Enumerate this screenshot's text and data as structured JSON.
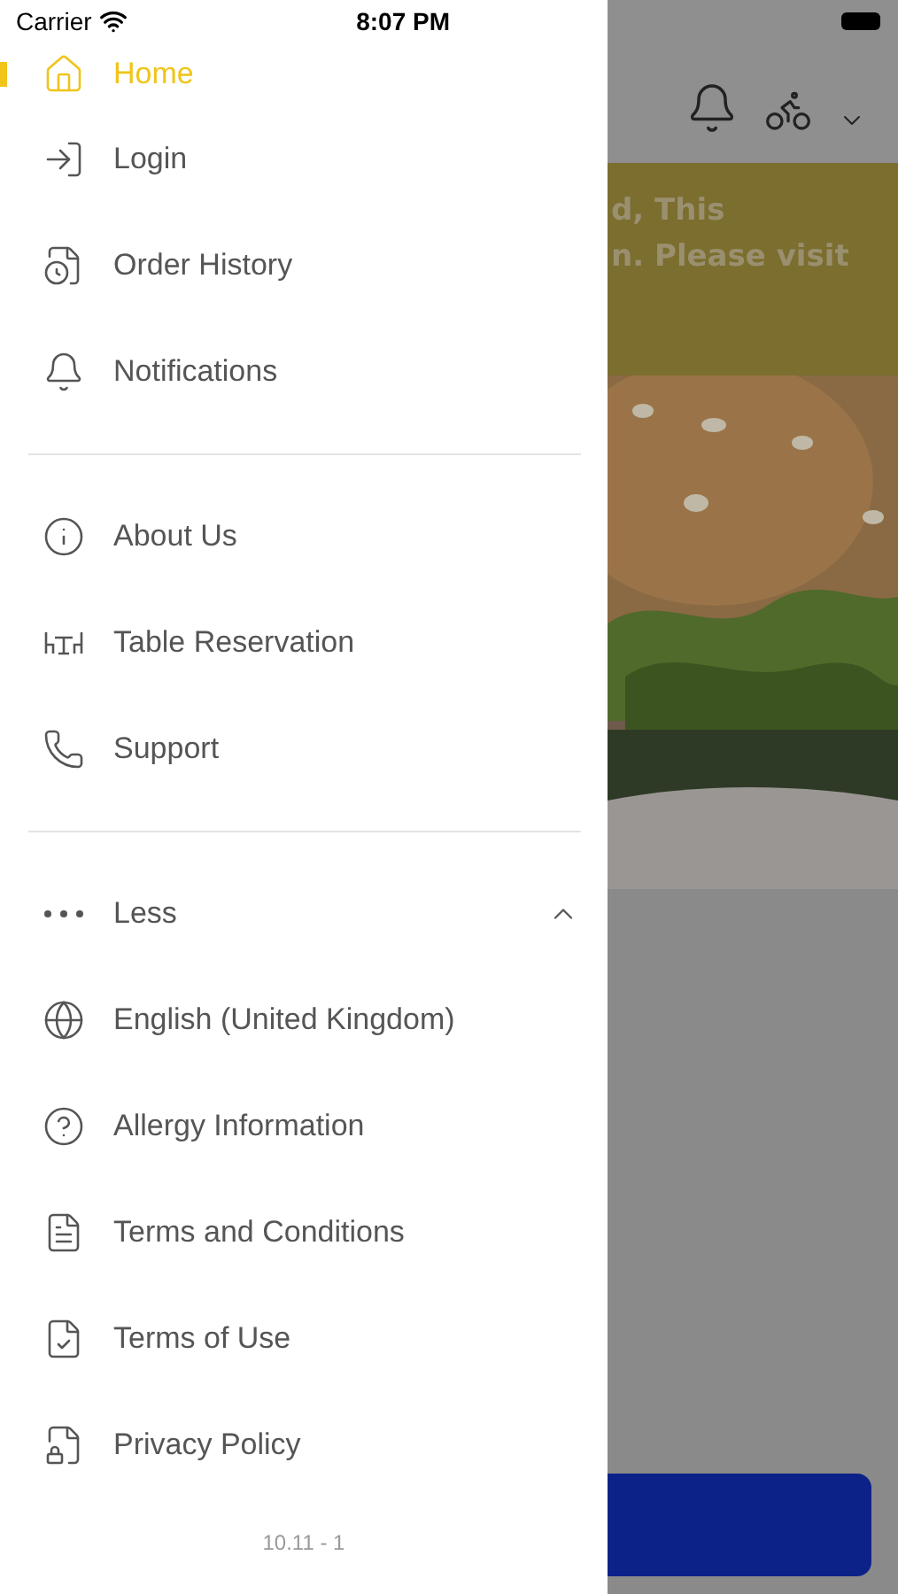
{
  "status_bar": {
    "carrier": "Carrier",
    "time": "8:07 PM"
  },
  "menu": {
    "sections": [
      {
        "items": [
          {
            "kind": "home",
            "label": "Home",
            "selected": true
          },
          {
            "kind": "login",
            "label": "Login",
            "selected": false
          },
          {
            "kind": "history",
            "label": "Order History",
            "selected": false
          },
          {
            "kind": "bell",
            "label": "Notifications",
            "selected": false
          }
        ]
      },
      {
        "items": [
          {
            "kind": "info",
            "label": "About Us",
            "selected": false
          },
          {
            "kind": "table",
            "label": "Table Reservation",
            "selected": false
          },
          {
            "kind": "phone",
            "label": "Support",
            "selected": false
          }
        ]
      },
      {
        "toggle": {
          "label": "Less",
          "expanded": true
        },
        "items": [
          {
            "kind": "globe",
            "label": "English (United Kingdom)",
            "selected": false
          },
          {
            "kind": "help",
            "label": "Allergy Information",
            "selected": false
          },
          {
            "kind": "doc",
            "label": "Terms and Conditions",
            "selected": false
          },
          {
            "kind": "doccheck",
            "label": "Terms of Use",
            "selected": false
          },
          {
            "kind": "privacy",
            "label": "Privacy Policy",
            "selected": false
          }
        ]
      }
    ],
    "version": "10.11 - 1"
  },
  "background": {
    "banner_lines": [
      "d, This",
      "n. Please visit"
    ],
    "hero": {
      "kind": "picture"
    }
  }
}
